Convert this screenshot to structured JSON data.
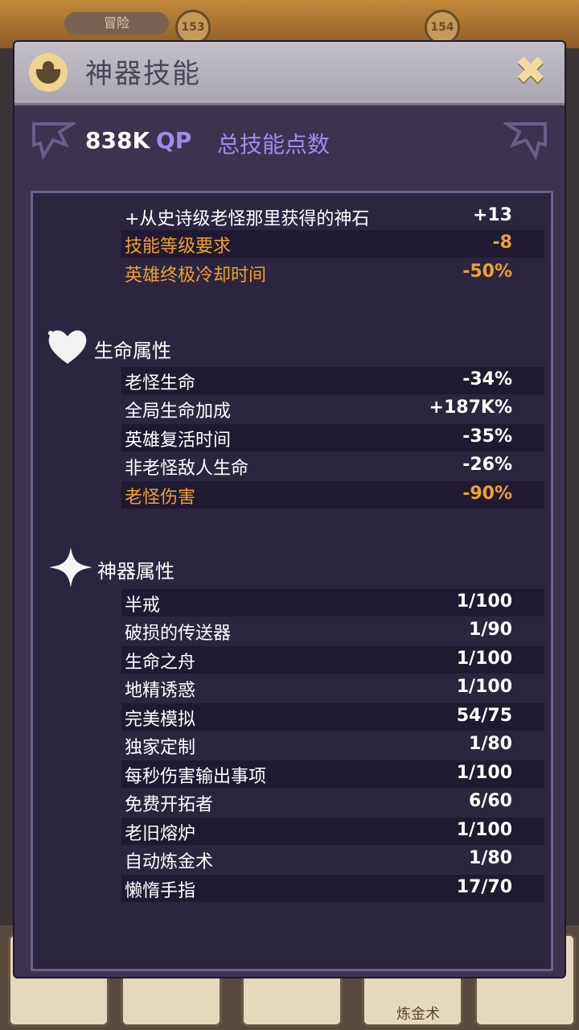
{
  "background": {
    "tab_label": "冒险",
    "level_left": "153",
    "level_right": "154",
    "bottom_tab_label": "炼金术"
  },
  "dialog": {
    "title": "神器技能",
    "close_icon": "close-icon"
  },
  "summary": {
    "qp_value": "838K",
    "qp_unit": "QP",
    "label": "总技能点数"
  },
  "top_rows": [
    {
      "label": "+从史诗级老怪那里获得的神石",
      "value": "+13",
      "highlight": false
    },
    {
      "label": "技能等级要求",
      "value": "-8",
      "highlight": true
    },
    {
      "label": "英雄终极冷却时间",
      "value": "-50%",
      "highlight": true
    }
  ],
  "life_section": {
    "title": "生命属性",
    "icon": "heart-icon",
    "rows": [
      {
        "label": "老怪生命",
        "value": "-34%",
        "highlight": false
      },
      {
        "label": "全局生命加成",
        "value": "+187K%",
        "highlight": false
      },
      {
        "label": "英雄复活时间",
        "value": "-35%",
        "highlight": false
      },
      {
        "label": "非老怪敌人生命",
        "value": "-26%",
        "highlight": false
      },
      {
        "label": "老怪伤害",
        "value": "-90%",
        "highlight": true
      }
    ]
  },
  "artifact_section": {
    "title": "神器属性",
    "icon": "sparkle-icon",
    "rows": [
      {
        "label": "半戒",
        "value": "1/100"
      },
      {
        "label": "破损的传送器",
        "value": "1/90"
      },
      {
        "label": "生命之舟",
        "value": "1/100"
      },
      {
        "label": "地精诱惑",
        "value": "1/100"
      },
      {
        "label": "完美模拟",
        "value": "54/75"
      },
      {
        "label": "独家定制",
        "value": "1/80"
      },
      {
        "label": "每秒伤害输出事项",
        "value": "1/100"
      },
      {
        "label": "免费开拓者",
        "value": "6/60"
      },
      {
        "label": "老旧熔炉",
        "value": "1/100"
      },
      {
        "label": "自动炼金术",
        "value": "1/80"
      },
      {
        "label": "懒惰手指",
        "value": "17/70"
      }
    ]
  }
}
